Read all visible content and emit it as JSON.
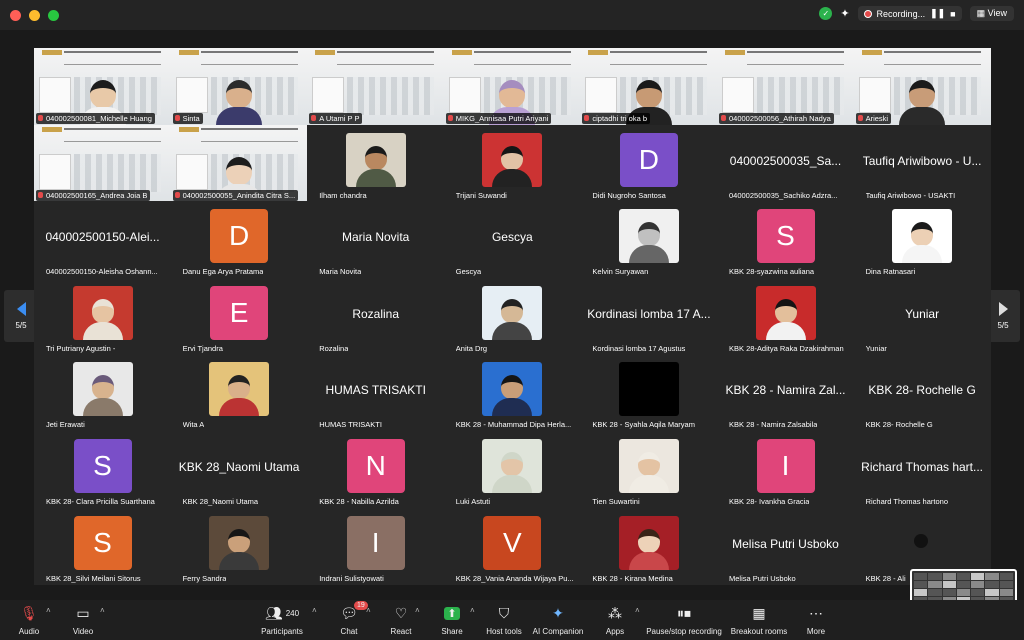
{
  "titlebar": {
    "recording_label": "Recording...",
    "view_label": "View"
  },
  "page_indicator": {
    "left": "5/5",
    "right": "5/5"
  },
  "tiles": [
    {
      "name": "040002500081_Michelle Huang",
      "kind": "slide-person",
      "skin": "#e8c9a8",
      "hair": "#1c1c1c",
      "shirt": "#f2f2f2"
    },
    {
      "name": "Sinta",
      "kind": "slide-person",
      "skin": "#d9b08c",
      "hair": "#2b2b2b",
      "shirt": "#3b3b6b"
    },
    {
      "name": "A Utami P P",
      "kind": "slide"
    },
    {
      "name": "MIKG_Annisaa Putri Ariyani",
      "kind": "slide-person",
      "skin": "#e2b996",
      "hair": "#a58dbf",
      "shirt": "#b9a0d4"
    },
    {
      "name": "ciptadhi tri oka b",
      "kind": "slide-person",
      "skin": "#c79a74",
      "hair": "#1a1a1a",
      "shirt": "#222"
    },
    {
      "name": "040002500056_Athirah Nadya",
      "kind": "slide"
    },
    {
      "name": "Arieski",
      "kind": "slide-person",
      "skin": "#c89c78",
      "hair": "#1b1b1b",
      "shirt": "#2a2a2a"
    },
    {
      "name": "040002500165_Andrea Joia B",
      "kind": "slide"
    },
    {
      "name": "040002500055_Anindita Citra S...",
      "kind": "slide-person",
      "skin": "#ecd1b8",
      "hair": "#1d1d1d",
      "shirt": "#e7e7e7"
    },
    {
      "name": "Ilham chandra",
      "kind": "photo",
      "skin": "#b98860",
      "hair": "#1a1a1a",
      "shirt": "#505a45",
      "bg": "#d8d2c4"
    },
    {
      "name": "Trijani Suwandi",
      "kind": "photo",
      "skin": "#e2c2a5",
      "hair": "#161616",
      "shirt": "#222",
      "bg": "#cc3333"
    },
    {
      "name": "Didi Nugroho Santosa",
      "kind": "letter",
      "letter": "D",
      "color": "#7a4fc8"
    },
    {
      "name": "040002500035_Sachiko Adzra...",
      "kind": "text",
      "display": "040002500035_Sa..."
    },
    {
      "name": "Taufiq Ariwibowo - USAKTI",
      "kind": "text",
      "display": "Taufiq Ariwibowo - U..."
    },
    {
      "name": "040002500150-Aleisha Oshann...",
      "kind": "text",
      "display": "040002500150-Alei..."
    },
    {
      "name": "Danu Ega Arya Pratama",
      "kind": "letter",
      "letter": "D",
      "color": "#e0672a"
    },
    {
      "name": "Maria Novita",
      "kind": "text",
      "display": "Maria Novita"
    },
    {
      "name": "Gescya",
      "kind": "text",
      "display": "Gescya"
    },
    {
      "name": "Kelvin Suryawan",
      "kind": "photo",
      "skin": "#c0c0c0",
      "hair": "#333",
      "shirt": "#666",
      "bg": "#f0f0f0"
    },
    {
      "name": "KBK 28-syazwina auliana",
      "kind": "letter",
      "letter": "S",
      "color": "#e0457a"
    },
    {
      "name": "Dina Ratnasari",
      "kind": "photo",
      "skin": "#ecd0b5",
      "hair": "#1a1a1a",
      "shirt": "#f5f5f5",
      "bg": "#ffffff"
    },
    {
      "name": "Tri Putriany Agustin -",
      "kind": "photo",
      "skin": "#e6c4a2",
      "hair": "#e9e2d6",
      "shirt": "#e9e2d6",
      "bg": "#c53a2f"
    },
    {
      "name": "Ervi Tjandra",
      "kind": "letter",
      "letter": "E",
      "color": "#e0457a"
    },
    {
      "name": "Rozalina",
      "kind": "text",
      "display": "Rozalina"
    },
    {
      "name": "Anita Drg",
      "kind": "photo",
      "skin": "#d5b896",
      "hair": "#222",
      "shirt": "#444",
      "bg": "#e6eef4"
    },
    {
      "name": "Kordinasi lomba 17 Agustus",
      "kind": "text",
      "display": "Kordinasi lomba 17 A..."
    },
    {
      "name": "KBK 28-Aditya Raka Dzakirahman",
      "kind": "photo",
      "skin": "#e3bf9b",
      "hair": "#141414",
      "shirt": "#f2f2f2",
      "bg": "#c82b2b"
    },
    {
      "name": "Yuniar",
      "kind": "text",
      "display": "Yuniar"
    },
    {
      "name": "Jeti Erawati",
      "kind": "photo",
      "skin": "#d8b38e",
      "hair": "#6a5a7a",
      "shirt": "#8a7a6a",
      "bg": "#e8e8e8"
    },
    {
      "name": "Wita A",
      "kind": "photo",
      "skin": "#d9b08a",
      "hair": "#222",
      "shirt": "#b33",
      "bg": "#e4c37a"
    },
    {
      "name": "HUMAS TRISAKTI",
      "kind": "text",
      "display": "HUMAS TRISAKTI"
    },
    {
      "name": "KBK 28 - Muhammad Dipa Herla...",
      "kind": "photo",
      "skin": "#c99e78",
      "hair": "#151515",
      "shirt": "#1f2d52",
      "bg": "#2a6fd0"
    },
    {
      "name": "KBK 28 - Syahla Aqila Maryam",
      "kind": "photo",
      "skin": "#000",
      "hair": "#000",
      "shirt": "#000",
      "bg": "#000000"
    },
    {
      "name": "KBK 28 - Namira Zalsabila",
      "kind": "text",
      "display": "KBK 28 - Namira Zal..."
    },
    {
      "name": "KBK 28- Rochelle G",
      "kind": "text",
      "display": "KBK 28- Rochelle G"
    },
    {
      "name": "KBK 28- Clara Pricilla Suarthana",
      "kind": "letter",
      "letter": "S",
      "color": "#7a4fc8"
    },
    {
      "name": "KBK 28_Naomi Utama",
      "kind": "text",
      "display": "KBK 28_Naomi Utama"
    },
    {
      "name": "KBK 28 - Nabilla Azrilda",
      "kind": "letter",
      "letter": "N",
      "color": "#e0457a"
    },
    {
      "name": "Luki Astuti",
      "kind": "photo",
      "skin": "#e3c5a8",
      "hair": "#cfd6c8",
      "shirt": "#cfd6c8",
      "bg": "#dfe4da"
    },
    {
      "name": "Tien Suwartini",
      "kind": "photo",
      "skin": "#e4c3a3",
      "hair": "#f0ece4",
      "shirt": "#f0ece4",
      "bg": "#ece7df"
    },
    {
      "name": "KBK 28- Ivankha Gracia",
      "kind": "letter",
      "letter": "I",
      "color": "#e0457a"
    },
    {
      "name": "Richard Thomas hartono",
      "kind": "text",
      "display": "Richard Thomas hart..."
    },
    {
      "name": "KBK 28_Silvi Meilani Sitorus",
      "kind": "letter",
      "letter": "S",
      "color": "#e0672a"
    },
    {
      "name": "Ferry Sandra",
      "kind": "photo",
      "skin": "#caa07a",
      "hair": "#161616",
      "shirt": "#3a3a3a",
      "bg": "#5c4a3a"
    },
    {
      "name": "Indrani Sulistyowati",
      "kind": "letter",
      "letter": "I",
      "color": "#8a6f64"
    },
    {
      "name": "KBK 28_Vania Ananda Wijaya Pu...",
      "kind": "letter",
      "letter": "V",
      "color": "#c8471f"
    },
    {
      "name": "KBK 28 - Kirana Medina",
      "kind": "photo",
      "skin": "#edd2b8",
      "hair": "#3a2418",
      "shirt": "#c9474a",
      "bg": "#a51f26"
    },
    {
      "name": "Melisa Putri Usboko",
      "kind": "text",
      "display": "Melisa Putri Usboko"
    },
    {
      "name": "KBK 28 - Ali",
      "kind": "dark"
    }
  ],
  "toolbar": {
    "audio": "Audio",
    "video": "Video",
    "participants": "Participants",
    "participants_count": "240",
    "chat": "Chat",
    "chat_badge": "19",
    "react": "React",
    "share": "Share",
    "host_tools": "Host tools",
    "ai_companion": "AI Companion",
    "apps": "Apps",
    "pause_stop_recording": "Pause/stop recording",
    "breakout_rooms": "Breakout rooms",
    "more": "More"
  },
  "colors": {
    "accent": "#3b8df1",
    "mic_off": "#e34b4b",
    "share": "#2bb24c"
  }
}
